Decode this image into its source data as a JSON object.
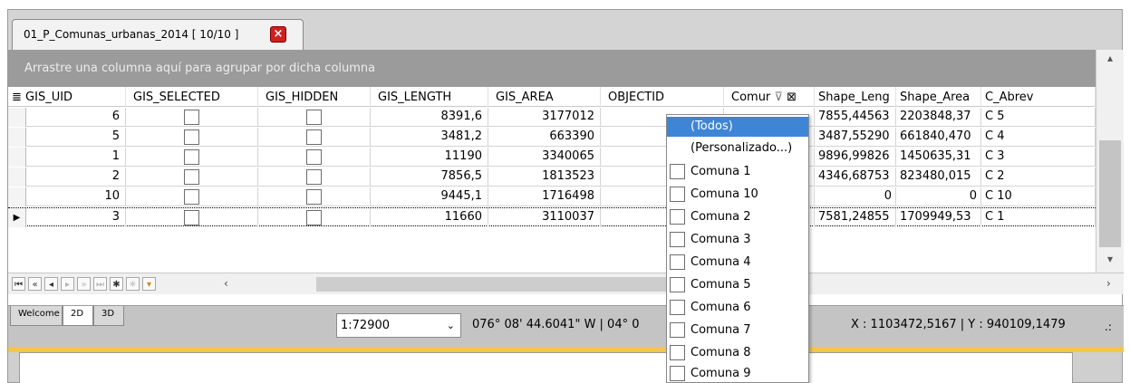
{
  "document_tab": {
    "title": "01_P_Comunas_urbanas_2014 [ 10/10 ]",
    "close_glyph": "×"
  },
  "group_panel": {
    "text": "Arrastre una columna aquí para agrupar por dicha columna"
  },
  "columns": [
    "GIS_UID",
    "GIS_SELECTED",
    "GIS_HIDDEN",
    "GIS_LENGTH",
    "GIS_AREA",
    "OBJECTID",
    "Comur",
    "Shape_Leng",
    "Shape_Area",
    "C_Abrev"
  ],
  "header_icons": {
    "selector": "≣",
    "filter": "⊽",
    "filter_dropdown": "⊠"
  },
  "rows": [
    {
      "gis_uid": "6",
      "gis_length": "8391,6",
      "gis_area": "3177012",
      "shape_leng": "7855,44563",
      "shape_area": "2203848,37",
      "c_abrev": "C 5"
    },
    {
      "gis_uid": "5",
      "gis_length": "3481,2",
      "gis_area": "663390",
      "shape_leng": "3487,55290",
      "shape_area": "661840,470",
      "c_abrev": "C 4"
    },
    {
      "gis_uid": "1",
      "gis_length": "11190",
      "gis_area": "3340065",
      "shape_leng": "9896,99826",
      "shape_area": "1450635,31",
      "c_abrev": "C 3"
    },
    {
      "gis_uid": "2",
      "gis_length": "7856,5",
      "gis_area": "1813523",
      "shape_leng": "4346,68753",
      "shape_area": "823480,015",
      "c_abrev": "C 2"
    },
    {
      "gis_uid": "10",
      "gis_length": "9445,1",
      "gis_area": "1716498",
      "shape_leng": "0",
      "shape_area": "0",
      "c_abrev": "C 10"
    },
    {
      "gis_uid": "3",
      "gis_length": "11660",
      "gis_area": "3110037",
      "shape_leng": "7581,24855",
      "shape_area": "1709949,53",
      "c_abrev": "C 1"
    }
  ],
  "current_row_marker": "▶",
  "filter_dropdown": {
    "special_items": [
      "(Todos)",
      "(Personalizado...)"
    ],
    "items": [
      "Comuna 1",
      "Comuna 10",
      "Comuna 2",
      "Comuna 3",
      "Comuna 4",
      "Comuna 5",
      "Comuna 6",
      "Comuna 7",
      "Comuna 8",
      "Comuna 9"
    ]
  },
  "nav_icons": {
    "first": "⏮",
    "prev_page": "«",
    "prev": "◂",
    "next": "▸",
    "next_page": "»",
    "last": "⏭",
    "add": "✱",
    "add_dim": "✳",
    "filter": "▾"
  },
  "scroll_icons": {
    "up": "▴",
    "down": "▾",
    "left": "‹",
    "right": "›"
  },
  "view_tabs": [
    "Welcome",
    "2D",
    "3D"
  ],
  "status": {
    "scale": "1:72900",
    "scale_arrow": "⌄",
    "coord_dms": "076° 08' 44.6041\" W | 04° 0",
    "coord_xy": "X : 1103472,5167 | Y : 940109,1479",
    "grip": ".:"
  },
  "colors": {
    "group_panel": "#9b9b9b",
    "selection": "#3f85d6",
    "close_button": "#d02020",
    "accent_band": "#f2c64a"
  }
}
